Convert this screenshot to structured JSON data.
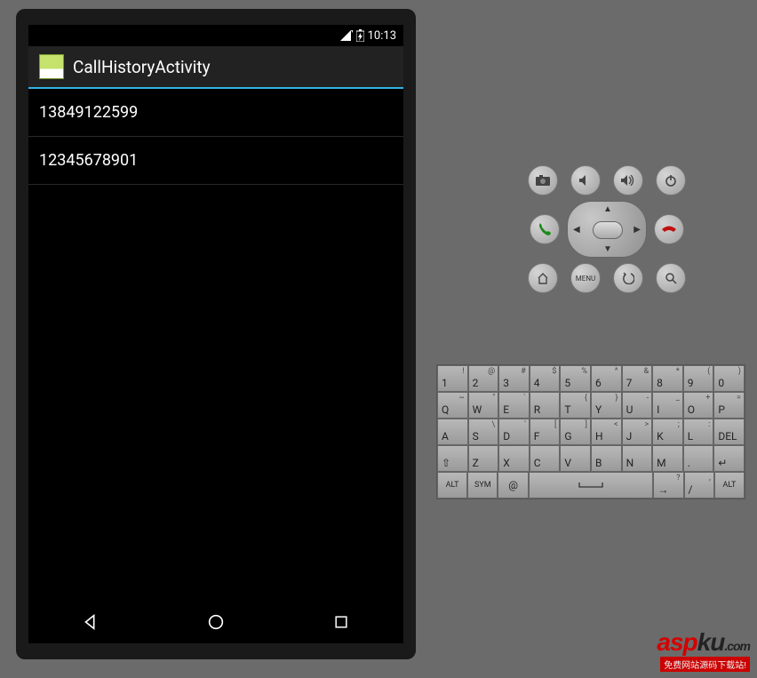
{
  "status_bar": {
    "time": "10:13"
  },
  "action_bar": {
    "title": "CallHistoryActivity"
  },
  "call_list": [
    {
      "number": "13849122599"
    },
    {
      "number": "12345678901"
    }
  ],
  "controls": {
    "row1": [
      "camera",
      "vol-down",
      "vol-up",
      "power"
    ],
    "row2": [
      "call",
      "dpad",
      "end-call"
    ],
    "row3": [
      "home",
      "menu",
      "back",
      "search"
    ],
    "menu_label": "MENU"
  },
  "keyboard": {
    "row1": [
      {
        "m": "1",
        "a": "!"
      },
      {
        "m": "2",
        "a": "@"
      },
      {
        "m": "3",
        "a": "#"
      },
      {
        "m": "4",
        "a": "$"
      },
      {
        "m": "5",
        "a": "%"
      },
      {
        "m": "6",
        "a": "^"
      },
      {
        "m": "7",
        "a": "&"
      },
      {
        "m": "8",
        "a": "*"
      },
      {
        "m": "9",
        "a": "("
      },
      {
        "m": "0",
        "a": ")"
      }
    ],
    "row2": [
      {
        "m": "Q",
        "a": "~"
      },
      {
        "m": "W",
        "a": "\""
      },
      {
        "m": "E",
        "a": "`"
      },
      {
        "m": "R",
        "a": ""
      },
      {
        "m": "T",
        "a": "{"
      },
      {
        "m": "Y",
        "a": "}"
      },
      {
        "m": "U",
        "a": "-"
      },
      {
        "m": "I",
        "a": "_"
      },
      {
        "m": "O",
        "a": "+"
      },
      {
        "m": "P",
        "a": "="
      }
    ],
    "row3": [
      {
        "m": "A",
        "a": ""
      },
      {
        "m": "S",
        "a": "\\"
      },
      {
        "m": "D",
        "a": "'"
      },
      {
        "m": "F",
        "a": "["
      },
      {
        "m": "G",
        "a": "]"
      },
      {
        "m": "H",
        "a": "<"
      },
      {
        "m": "J",
        "a": ">"
      },
      {
        "m": "K",
        "a": ";"
      },
      {
        "m": "L",
        "a": ":"
      },
      {
        "m": "DEL",
        "a": ""
      }
    ],
    "row4": [
      {
        "m": "⇧",
        "a": ""
      },
      {
        "m": "Z",
        "a": ""
      },
      {
        "m": "X",
        "a": ""
      },
      {
        "m": "C",
        "a": ""
      },
      {
        "m": "V",
        "a": ""
      },
      {
        "m": "B",
        "a": ""
      },
      {
        "m": "N",
        "a": ""
      },
      {
        "m": "M",
        "a": ""
      },
      {
        "m": ".",
        "a": ""
      },
      {
        "m": "↵",
        "a": ""
      }
    ],
    "row5": {
      "alt_left": "ALT",
      "sym": "SYM",
      "at": "@",
      "space": "␣",
      "arrow": "→",
      "slash": "/",
      "comma": ",",
      "alt_right": "ALT",
      "question": "?"
    }
  },
  "watermark": {
    "brand": "aspku",
    "tld": ".com",
    "tagline": "免费网站源码下载站!"
  }
}
